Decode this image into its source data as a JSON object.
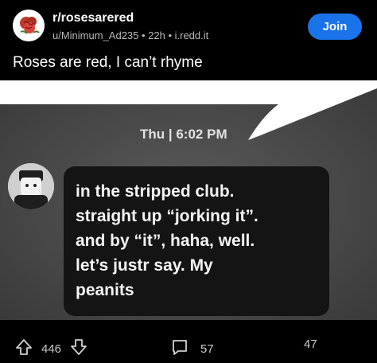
{
  "post": {
    "subreddit": "r/rosesarered",
    "meta": "u/Minimum_Ad235 • 22h • i.redd.it",
    "join_label": "Join",
    "title": "Roses are red, I can’t rhyme"
  },
  "image": {
    "timestamp": "Thu | 6:02 PM",
    "message": "in the stripped club.\nstraight up “jorking it”.\nand by “it”, haha, well.\nlet’s justr say. My\npeanits"
  },
  "actions": {
    "upvotes": "446",
    "comments": "57",
    "shares": "47"
  },
  "colors": {
    "accent": "#1a73e8",
    "background": "#000000"
  },
  "icons": [
    "rose-avatar-icon",
    "upvote-icon",
    "downvote-icon",
    "comment-icon"
  ]
}
